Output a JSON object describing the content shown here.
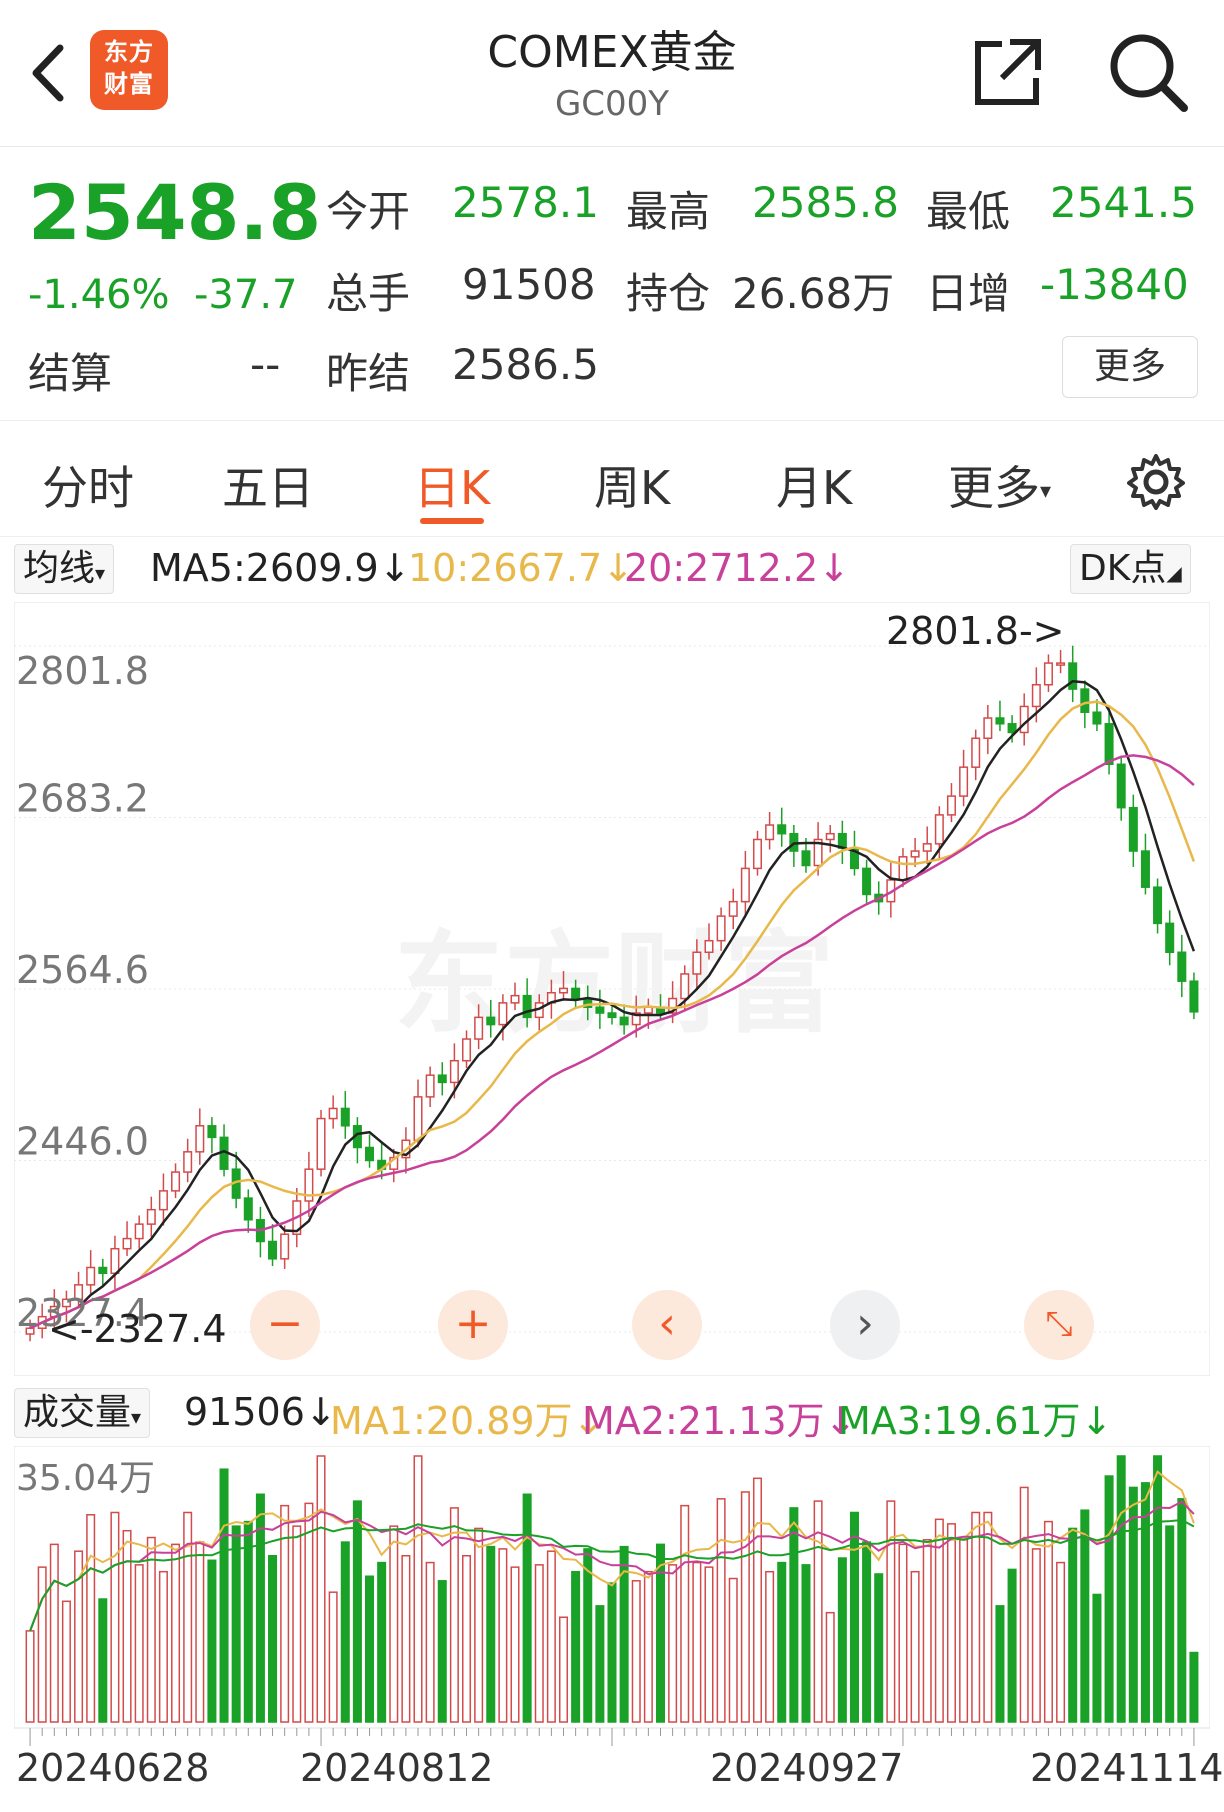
{
  "header": {
    "logo_line1": "东方",
    "logo_line2": "财富",
    "title": "COMEX黄金",
    "subtitle": "GC00Y"
  },
  "quote": {
    "price": "2548.8",
    "change_pct": "-1.46%",
    "change": "-37.7",
    "open_label": "今开",
    "open": "2578.1",
    "high_label": "最高",
    "high": "2585.8",
    "low_label": "最低",
    "low": "2541.5",
    "volume_label": "总手",
    "volume": "91508",
    "oi_label": "持仓",
    "oi": "26.68万",
    "daily_inc_label": "日增",
    "daily_inc": "-13840",
    "settle_label": "结算",
    "settle": "--",
    "prev_settle_label": "昨结",
    "prev_settle": "2586.5",
    "more_label": "更多"
  },
  "tabs": [
    "分时",
    "五日",
    "日K",
    "周K",
    "月K",
    "更多"
  ],
  "active_tab": "日K",
  "ma_bar": {
    "selector": "均线",
    "ma5": "MA5:2609.9",
    "ma10": "10:2667.7",
    "ma20": "20:2712.2",
    "dk": "DK点"
  },
  "vol_bar": {
    "selector": "成交量",
    "vol": "91506",
    "ma1": "MA1:20.89万",
    "ma2": "MA2:21.13万",
    "ma3": "MA3:19.61万"
  },
  "colors": {
    "up": "#d24b4b",
    "down": "#1aa127",
    "ma5": "#222222",
    "ma10": "#e9b84a",
    "ma20": "#c8409a",
    "accent": "#f05a28"
  },
  "chart_data": [
    {
      "type": "candlestick",
      "y_ticks": [
        "2801.8",
        "2683.2",
        "2564.6",
        "2446.0",
        "2327.4"
      ],
      "ylim": [
        2327.4,
        2801.8
      ],
      "annotations": [
        "2801.8->",
        "<-2327.4"
      ],
      "x_labels": [
        "20240628",
        "20240812",
        "20240927",
        "20241114"
      ],
      "closes": [
        2330,
        2338,
        2345,
        2350,
        2360,
        2372,
        2368,
        2385,
        2392,
        2402,
        2412,
        2425,
        2438,
        2452,
        2470,
        2462,
        2440,
        2420,
        2405,
        2390,
        2378,
        2395,
        2418,
        2440,
        2475,
        2482,
        2470,
        2455,
        2446,
        2440,
        2448,
        2460,
        2490,
        2505,
        2500,
        2515,
        2530,
        2545,
        2540,
        2555,
        2560,
        2545,
        2555,
        2562,
        2565,
        2558,
        2552,
        2548,
        2545,
        2540,
        2548,
        2552,
        2548,
        2558,
        2575,
        2590,
        2598,
        2615,
        2625,
        2648,
        2668,
        2678,
        2672,
        2660,
        2650,
        2668,
        2672,
        2662,
        2648,
        2630,
        2625,
        2640,
        2656,
        2660,
        2665,
        2685,
        2698,
        2718,
        2738,
        2752,
        2748,
        2742,
        2760,
        2775,
        2790,
        2790,
        2772,
        2756,
        2748,
        2720,
        2690,
        2660,
        2635,
        2610,
        2590,
        2570,
        2548.8
      ],
      "ma5_last": 2609.9,
      "ma10_last": 2667.7,
      "ma20_last": 2712.2
    },
    {
      "type": "bar",
      "title": "成交量",
      "y_ticks": [
        "35.04万"
      ],
      "ylim": [
        0,
        350400
      ],
      "last_value": 91506,
      "ma1_last": 208900,
      "ma2_last": 211300,
      "ma3_last": 196100
    }
  ]
}
